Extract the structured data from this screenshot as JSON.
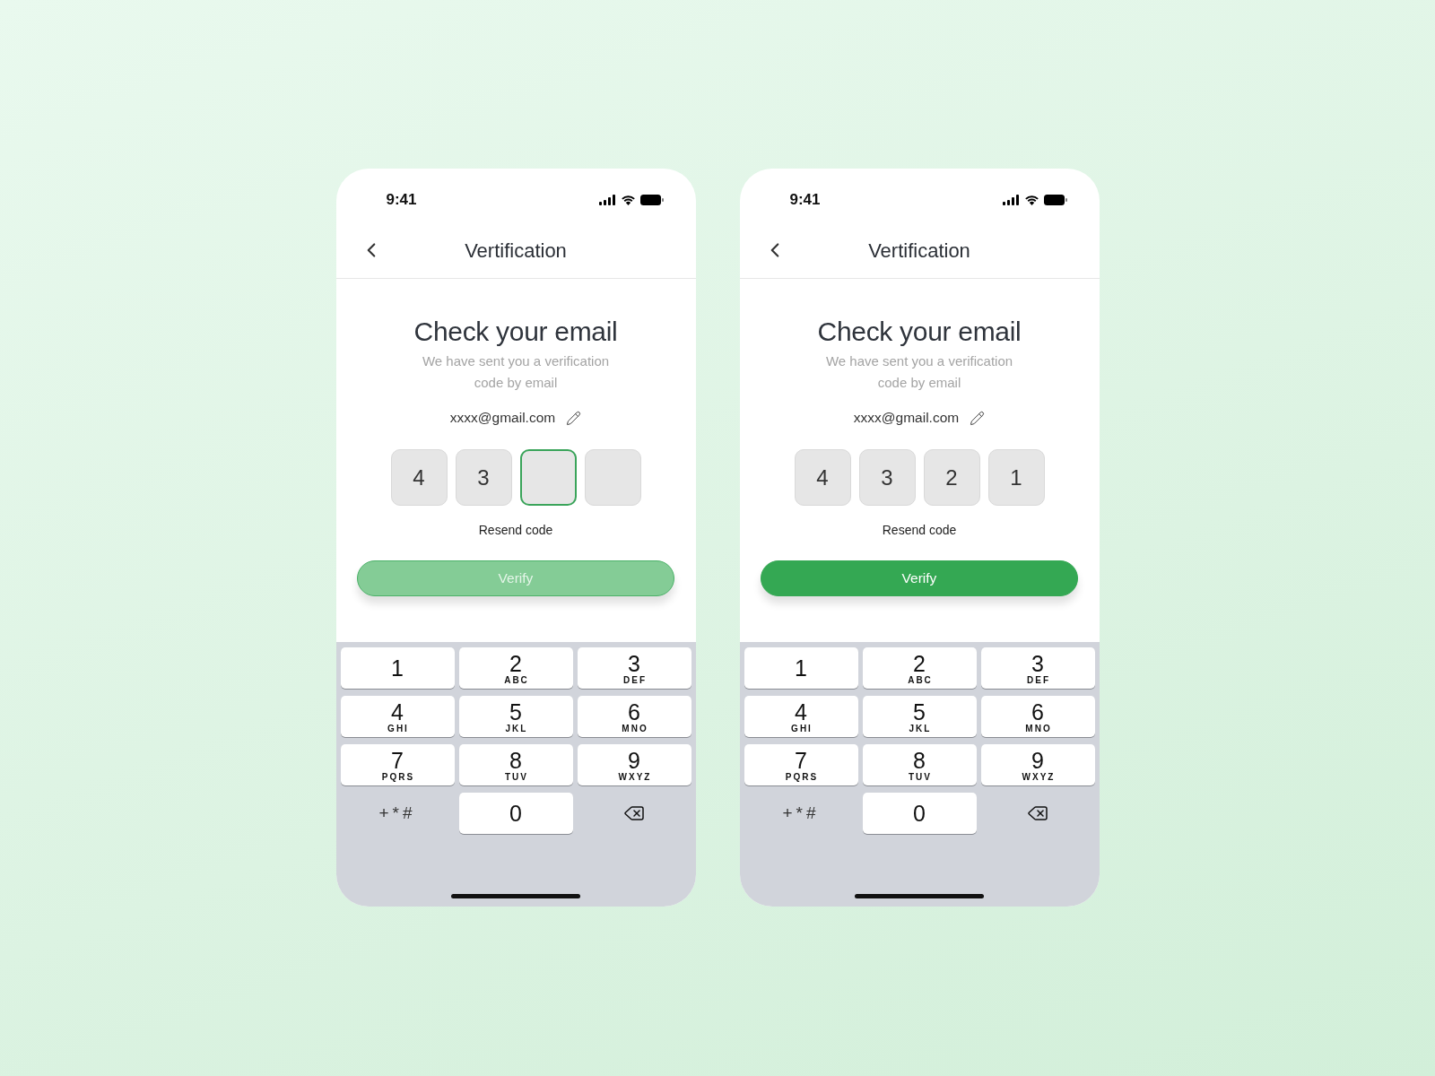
{
  "screens": [
    {
      "status_bar": {
        "time": "9:41"
      },
      "header": {
        "title": "Vertification"
      },
      "heading": "Check your email",
      "subtitle": "We have sent you a verification code by email",
      "email": "xxxx@gmail.com",
      "code": [
        {
          "value": "4",
          "focused": false
        },
        {
          "value": "3",
          "focused": false
        },
        {
          "focused": true
        },
        {
          "focused": false
        }
      ],
      "resend_link": "Resend code",
      "verify_button": {
        "label": "Verify",
        "disabled": true
      },
      "keypad": [
        {
          "kind": "digit",
          "digit": "1"
        },
        {
          "kind": "digit",
          "digit": "2",
          "letters": "ABC"
        },
        {
          "kind": "digit",
          "digit": "3",
          "letters": "DEF"
        },
        {
          "kind": "digit",
          "digit": "4",
          "letters": "GHI"
        },
        {
          "kind": "digit",
          "digit": "5",
          "letters": "JKL"
        },
        {
          "kind": "digit",
          "digit": "6",
          "letters": "MNO"
        },
        {
          "kind": "digit",
          "digit": "7",
          "letters": "PQRS"
        },
        {
          "kind": "digit",
          "digit": "8",
          "letters": "TUV"
        },
        {
          "kind": "digit",
          "digit": "9",
          "letters": "WXYZ"
        },
        {
          "kind": "symbols",
          "label": "+*#"
        },
        {
          "kind": "digit",
          "digit": "0"
        },
        {
          "kind": "backspace"
        }
      ]
    },
    {
      "status_bar": {
        "time": "9:41"
      },
      "header": {
        "title": "Vertification"
      },
      "heading": "Check your email",
      "subtitle": "We have sent you a verification code by email",
      "email": "xxxx@gmail.com",
      "code": [
        {
          "value": "4",
          "focused": false
        },
        {
          "value": "3",
          "focused": false
        },
        {
          "value": "2",
          "focused": false
        },
        {
          "value": "1",
          "focused": false
        }
      ],
      "resend_link": "Resend code",
      "verify_button": {
        "label": "Verify",
        "disabled": false
      },
      "keypad": [
        {
          "kind": "digit",
          "digit": "1"
        },
        {
          "kind": "digit",
          "digit": "2",
          "letters": "ABC"
        },
        {
          "kind": "digit",
          "digit": "3",
          "letters": "DEF"
        },
        {
          "kind": "digit",
          "digit": "4",
          "letters": "GHI"
        },
        {
          "kind": "digit",
          "digit": "5",
          "letters": "JKL"
        },
        {
          "kind": "digit",
          "digit": "6",
          "letters": "MNO"
        },
        {
          "kind": "digit",
          "digit": "7",
          "letters": "PQRS"
        },
        {
          "kind": "digit",
          "digit": "8",
          "letters": "TUV"
        },
        {
          "kind": "digit",
          "digit": "9",
          "letters": "WXYZ"
        },
        {
          "kind": "symbols",
          "label": "+*#"
        },
        {
          "kind": "digit",
          "digit": "0"
        },
        {
          "kind": "backspace"
        }
      ]
    }
  ]
}
